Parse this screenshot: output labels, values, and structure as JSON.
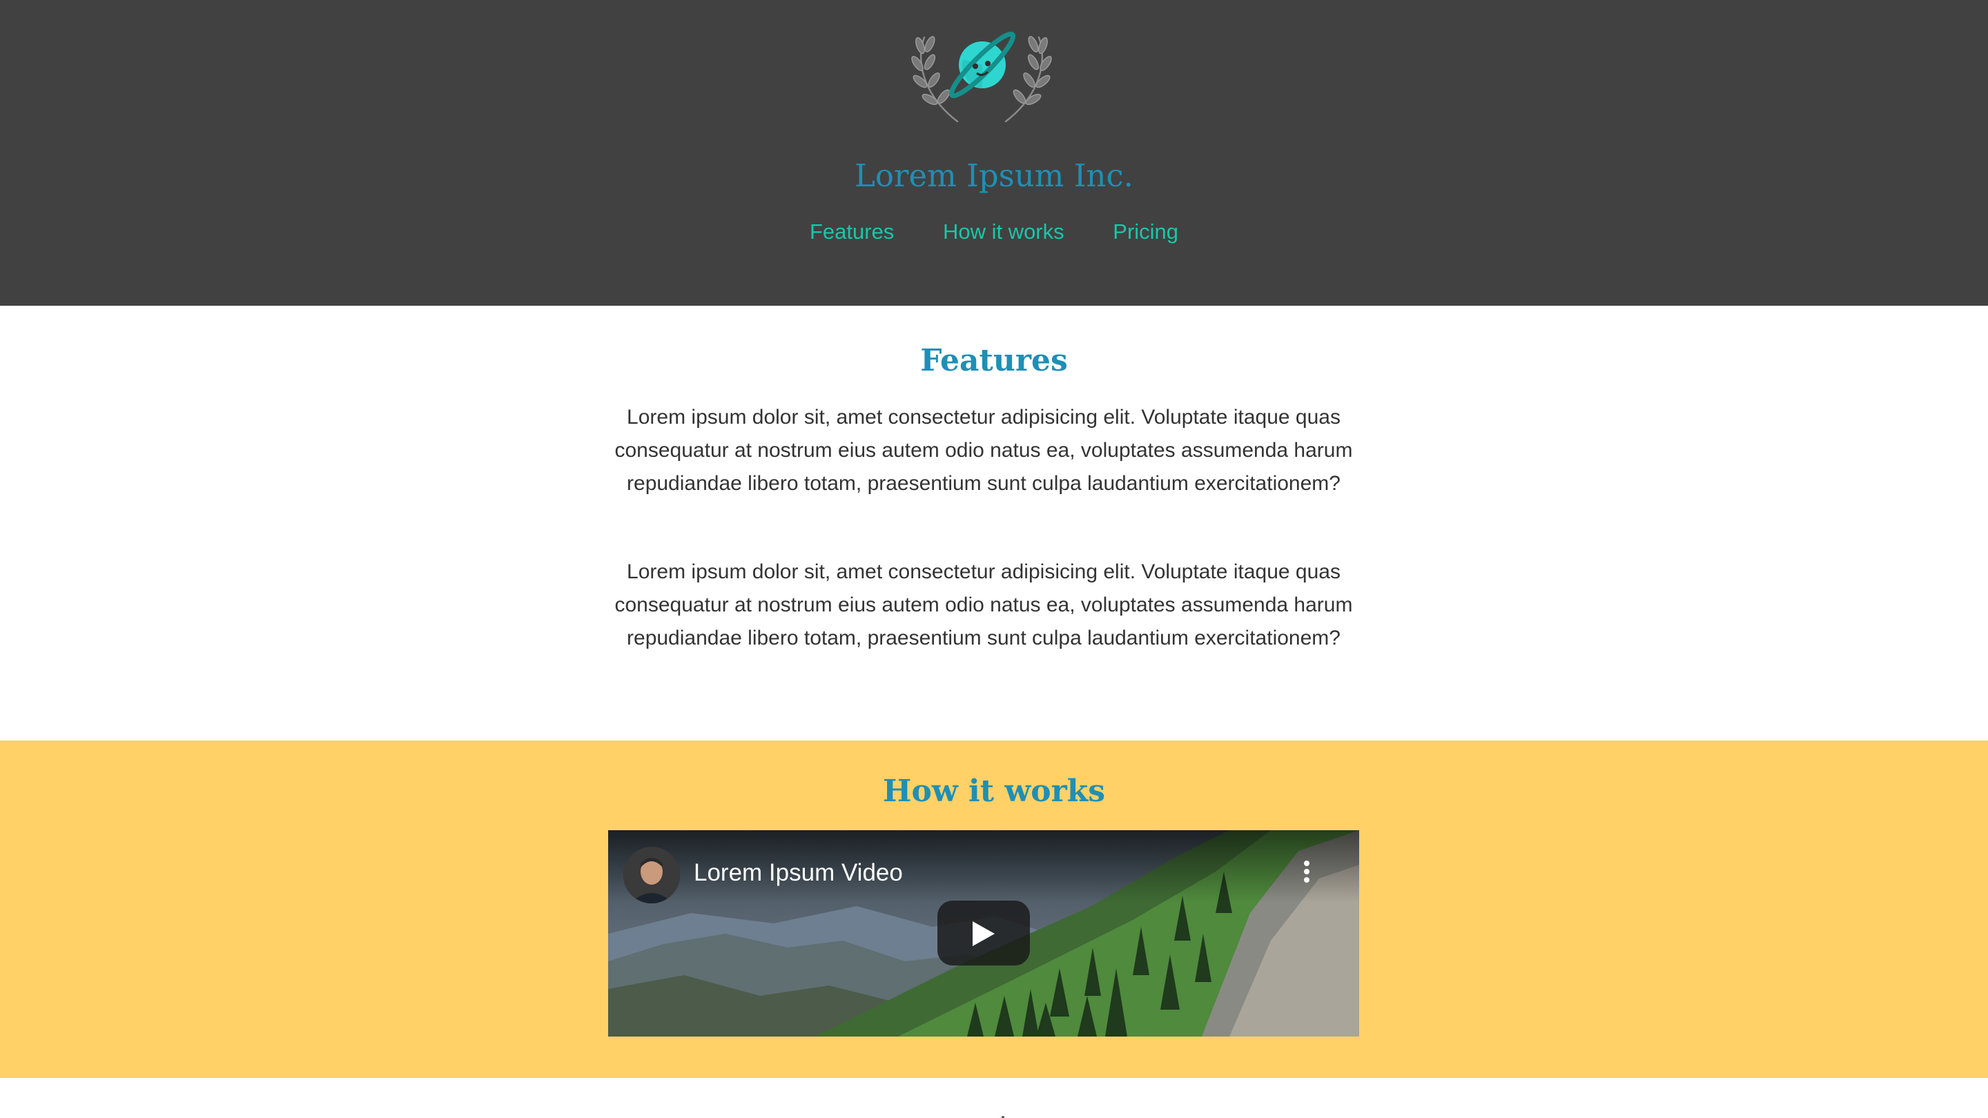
{
  "header": {
    "brand": "Lorem Ipsum Inc.",
    "logo_icon": "planet-laurel-icon",
    "nav": [
      "Features",
      "How it works",
      "Pricing"
    ]
  },
  "features": {
    "title": "Features",
    "paragraphs": [
      "Lorem ipsum dolor sit, amet consectetur adipisicing elit. Voluptate itaque quas consequatur at nostrum eius autem odio natus ea, voluptates assumenda harum repudiandae libero totam, praesentium sunt culpa laudantium exercitationem?",
      "Lorem ipsum dolor sit, amet consectetur adipisicing elit. Voluptate itaque quas consequatur at nostrum eius autem odio natus ea, voluptates assumenda harum repudiandae libero totam, praesentium sunt culpa laudantium exercitationem?"
    ]
  },
  "how_it_works": {
    "title": "How it works",
    "video": {
      "title": "Lorem Ipsum Video",
      "play_icon": "play-icon",
      "menu_icon": "more-vertical-icon"
    }
  },
  "colors": {
    "header_bg": "#414141",
    "brand": "#1f8fb5",
    "nav_link": "#19c7a8",
    "how_bg": "#ffd166",
    "text": "#333333"
  }
}
